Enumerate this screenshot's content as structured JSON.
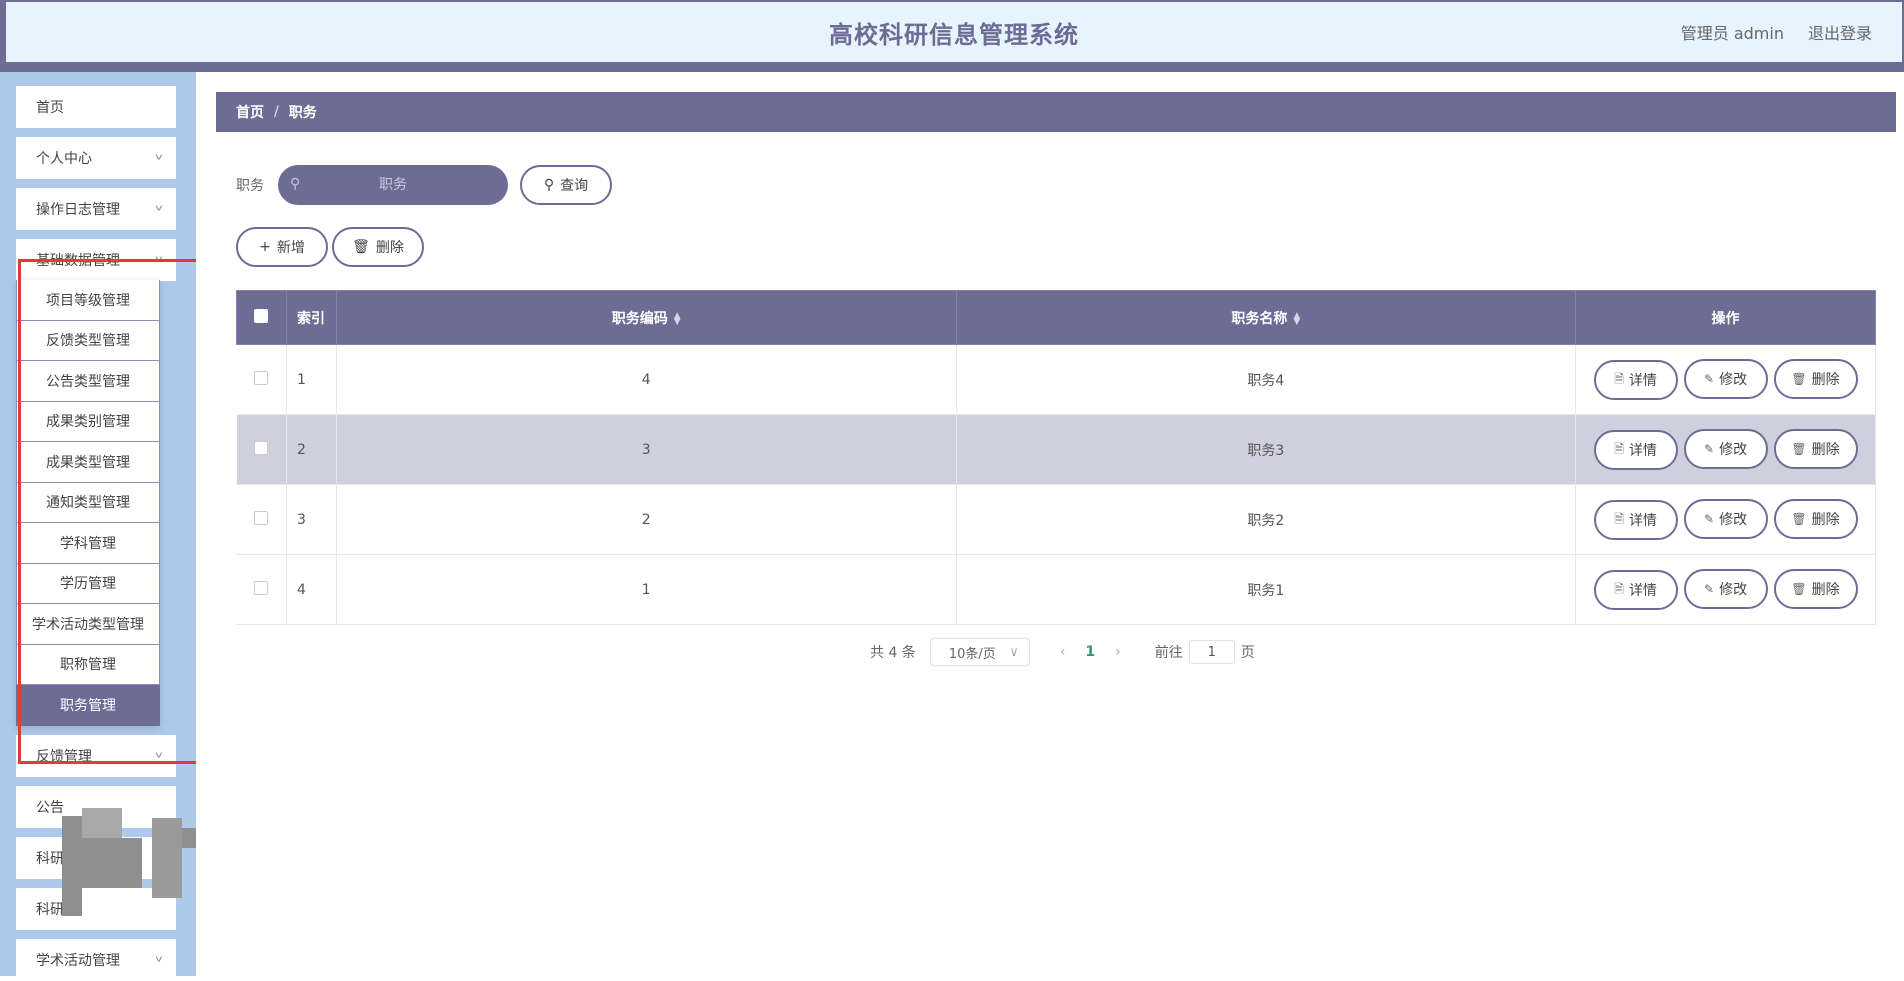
{
  "header": {
    "title": "高校科研信息管理系统",
    "user": "管理员 admin",
    "logout": "退出登录"
  },
  "sidebar": {
    "items": [
      {
        "label": "首页"
      },
      {
        "label": "个人中心"
      },
      {
        "label": "操作日志管理"
      },
      {
        "label": "基础数据管理"
      },
      {
        "label": "反馈管理"
      },
      {
        "label": "公告"
      },
      {
        "label": "科研"
      },
      {
        "label": "科研"
      },
      {
        "label": "学术活动管理"
      }
    ],
    "submenu": [
      "项目等级管理",
      "反馈类型管理",
      "公告类型管理",
      "成果类别管理",
      "成果类型管理",
      "通知类型管理",
      "学科管理",
      "学历管理",
      "学术活动类型管理",
      "职称管理",
      "职务管理"
    ],
    "active_submenu": "职务管理"
  },
  "breadcrumb": {
    "home": "首页",
    "separator": "/",
    "current": "职务"
  },
  "search": {
    "label": "职务",
    "placeholder": "职务",
    "query_button": "查询"
  },
  "actions": {
    "add": "新增",
    "delete": "删除"
  },
  "table": {
    "headers": {
      "index": "索引",
      "code": "职务编码",
      "name": "职务名称",
      "ops": "操作"
    },
    "rows": [
      {
        "index": "1",
        "code": "4",
        "name": "职务4"
      },
      {
        "index": "2",
        "code": "3",
        "name": "职务3"
      },
      {
        "index": "3",
        "code": "2",
        "name": "职务2"
      },
      {
        "index": "4",
        "code": "1",
        "name": "职务1"
      }
    ],
    "row_buttons": {
      "detail": "详情",
      "edit": "修改",
      "delete": "删除"
    }
  },
  "pagination": {
    "total": "共 4 条",
    "page_size": "10条/页",
    "current_page": "1",
    "goto_label": "前往",
    "goto_value": "1",
    "goto_suffix": "页"
  },
  "colors": {
    "primary": "#6d6c95",
    "sidebar_bg": "#aecaea",
    "header_bg": "#e8f4fd",
    "highlight_box": "#e03c3c"
  }
}
